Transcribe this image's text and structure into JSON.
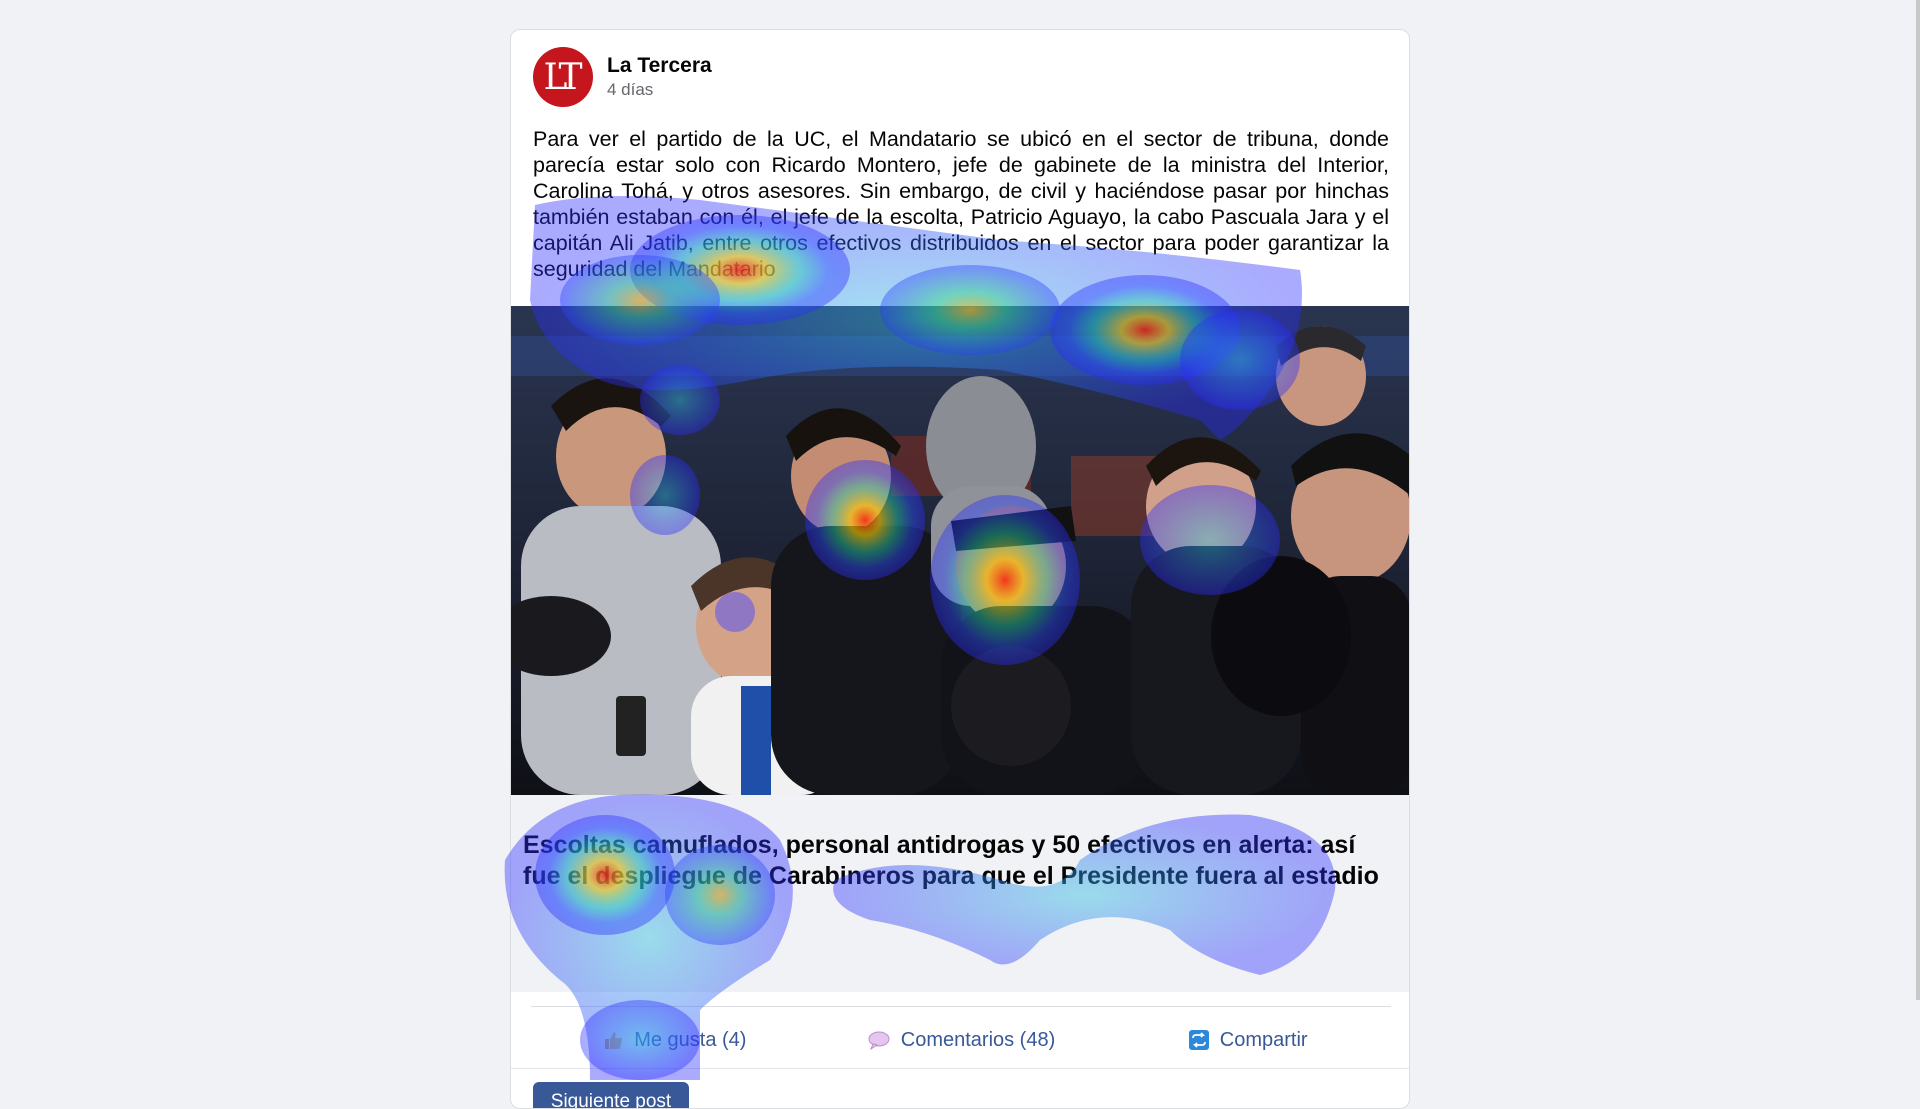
{
  "post": {
    "avatar_text": "LT",
    "source_name": "La Tercera",
    "time": "4 días",
    "body": "Para ver el partido de la UC, el Mandatario se ubicó en el sector de tribuna, donde parecía estar solo con Ricardo Montero, jefe de gabinete de la ministra del Interior, Carolina Tohá, y otros asesores. Sin embargo, de civil y haciéndose pasar por hinchas también estaban con él, el jefe de la escolta, Patricio Aguayo, la cabo Pascuala Jara y el capitán Ali Jatib, entre otros efectivos distribuidos en el sector para poder garantizar la seguridad del Mandatario",
    "link_title": "Escoltas camuflados, personal antidrogas y 50 efectivos en alerta: así fue el despliegue de Carabineros para que el Presidente fuera al estadio",
    "brand_color": "#c4161c"
  },
  "actions": {
    "like": {
      "icon": "thumbs-up-icon",
      "label": "Me gusta (4)"
    },
    "comment": {
      "icon": "speech-bubble-icon",
      "label": "Comentarios (48)"
    },
    "share": {
      "icon": "share-icon",
      "label": "Compartir"
    }
  },
  "next_button": {
    "label": "Siguiente post"
  },
  "colors": {
    "accent": "#385898",
    "page_background": "#f0f2f5",
    "card_background": "#ffffff"
  }
}
